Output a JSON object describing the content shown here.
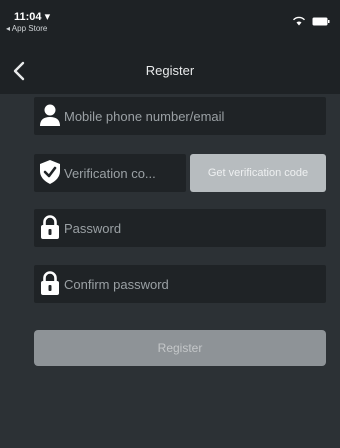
{
  "status_bar": {
    "time": "11:04 ▾",
    "back_app": "◂ App Store",
    "wifi_icon": "wifi-icon",
    "battery_icon": "battery-icon"
  },
  "nav": {
    "back_icon": "chevron-left-icon",
    "title": "Register"
  },
  "form": {
    "phone": {
      "placeholder": "Mobile phone number/email",
      "value": "",
      "icon": "user-icon"
    },
    "code": {
      "placeholder": "Verification co...",
      "value": "",
      "icon": "shield-check-icon"
    },
    "get_code_label": "Get verification code",
    "password": {
      "placeholder": "Password",
      "value": "",
      "icon": "lock-icon"
    },
    "confirm": {
      "placeholder": "Confirm password",
      "value": "",
      "icon": "lock-icon"
    },
    "register_label": "Register"
  },
  "colors": {
    "background": "#2c3135",
    "bar": "#1e2225",
    "field": "#1f2326",
    "get_code_button": "#b7bcbf",
    "register_button": "#8e9397"
  }
}
